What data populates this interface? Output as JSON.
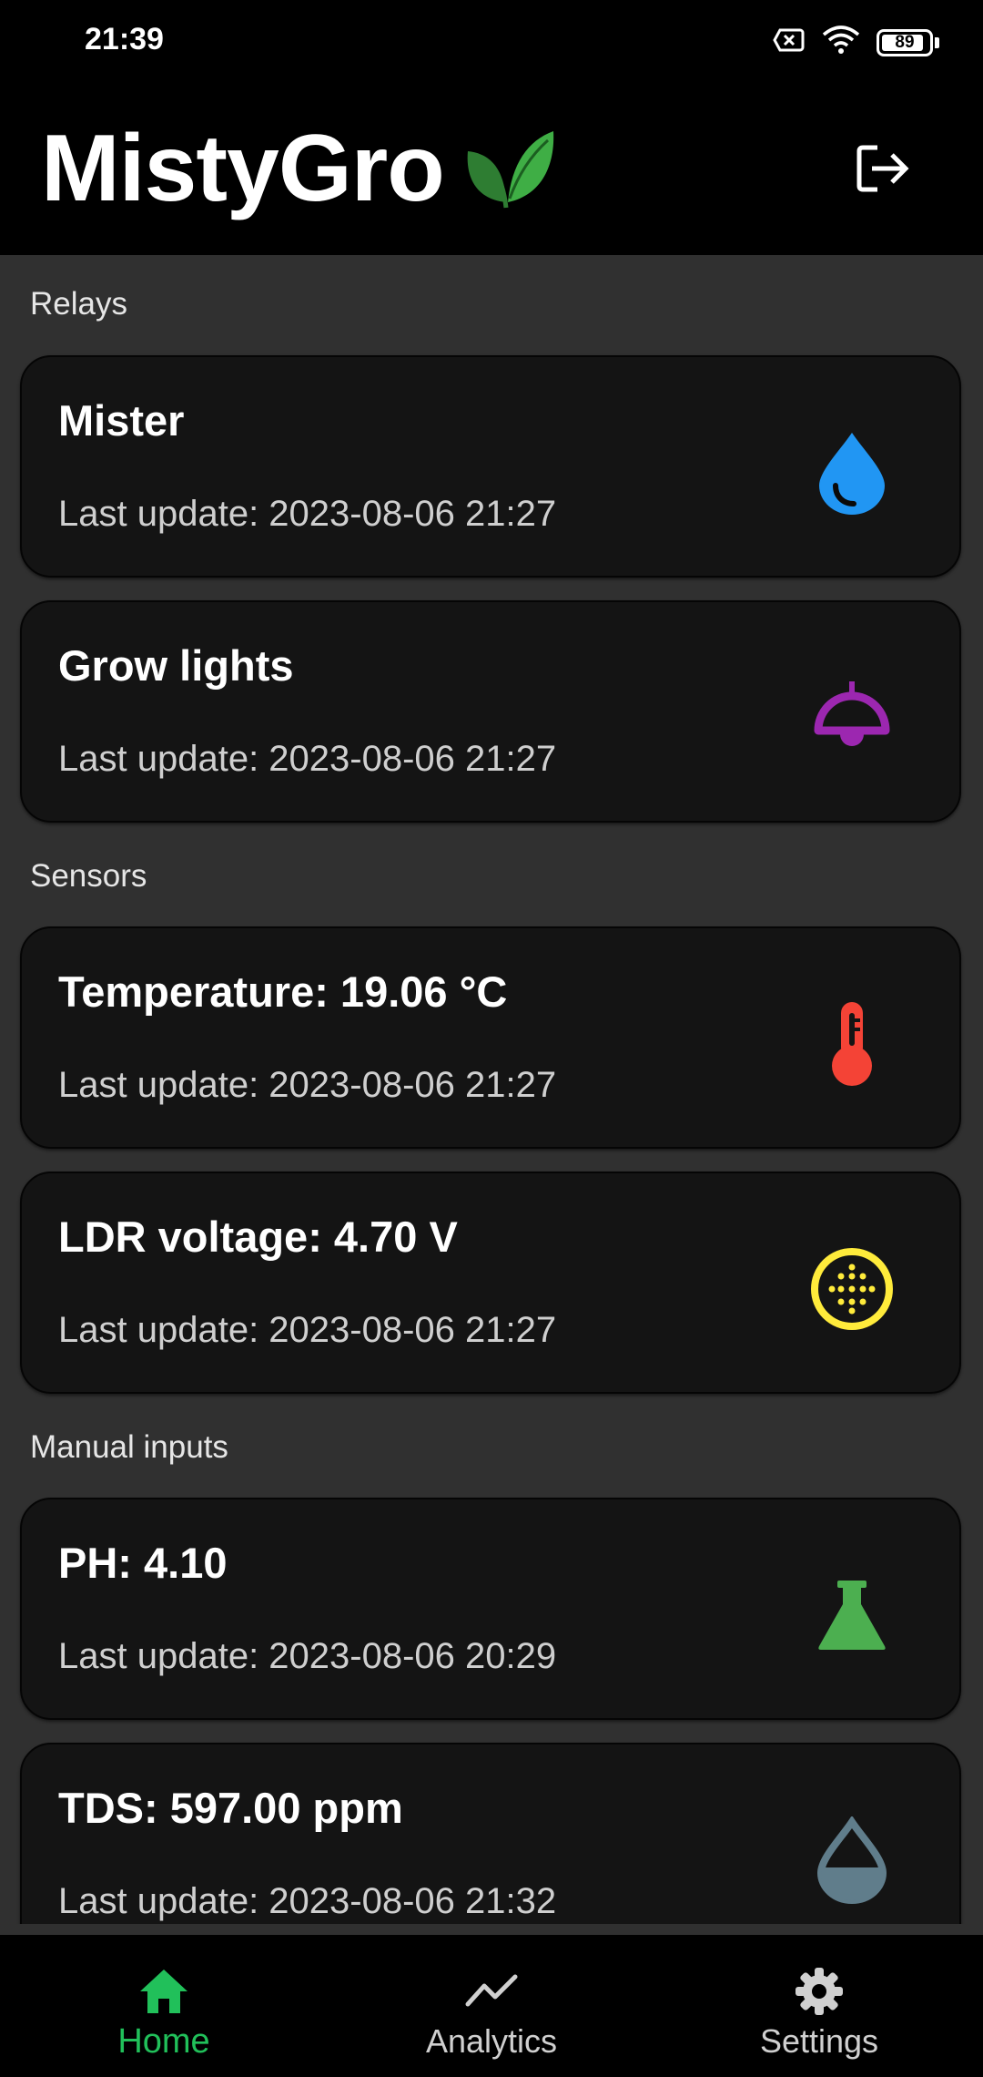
{
  "status_bar": {
    "time": "21:39",
    "battery": "89",
    "battery_level": 0.89
  },
  "app": {
    "title": "MistyGro"
  },
  "sections": {
    "relays": "Relays",
    "sensors": "Sensors",
    "manual_inputs": "Manual inputs"
  },
  "cards": {
    "mister": {
      "title": "Mister",
      "updated": "Last update: 2023-08-06 21:27",
      "icon": "water-drop-icon",
      "color": "#2196F3"
    },
    "grow_lights": {
      "title": "Grow lights",
      "updated": "Last update: 2023-08-06 21:27",
      "icon": "lamp-icon",
      "color": "#9C27B0"
    },
    "temperature": {
      "title": "Temperature: 19.06 °C",
      "updated": "Last update: 2023-08-06 21:27",
      "icon": "thermometer-icon",
      "color": "#F44336"
    },
    "ldr": {
      "title": "LDR voltage: 4.70 V",
      "updated": "Last update: 2023-08-06 21:27",
      "icon": "light-sensor-icon",
      "color": "#FFEB3B"
    },
    "ph": {
      "title": "PH: 4.10",
      "updated": "Last update: 2023-08-06 20:29",
      "icon": "flask-icon",
      "color": "#4CAF50"
    },
    "tds": {
      "title": "TDS: 597.00 ppm",
      "updated": "Last update: 2023-08-06 21:32",
      "icon": "half-drop-icon",
      "color": "#607D8B"
    }
  },
  "bottom_nav": {
    "home": "Home",
    "analytics": "Analytics",
    "settings": "Settings",
    "active_color": "#21C05A"
  }
}
